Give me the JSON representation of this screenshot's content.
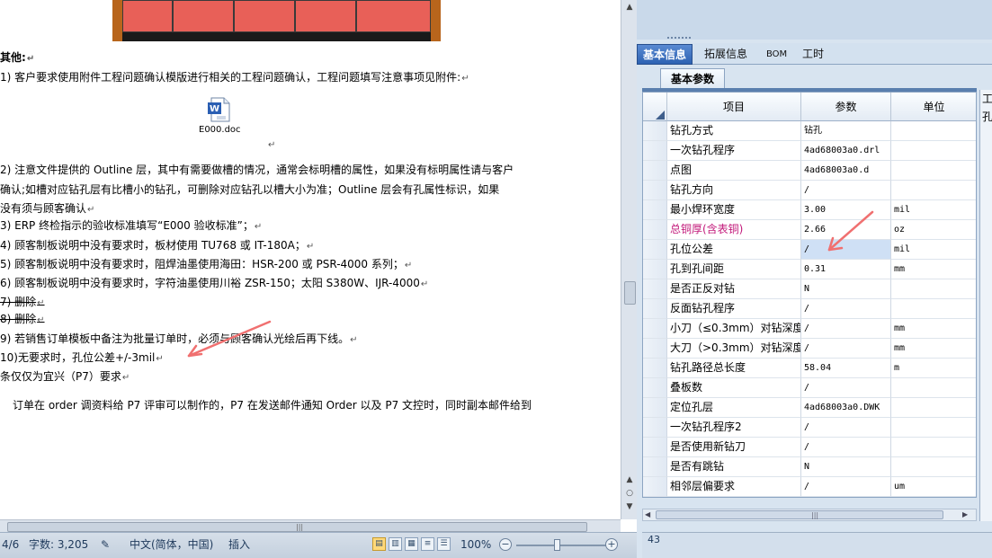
{
  "document": {
    "heading": "其他:",
    "items": [
      "1)  客户要求使用附件工程问题确认模版进行相关的工程问题确认，工程问题填写注意事项见附件:",
      "2)  注意文件提供的 Outline 层，其中有需要做槽的情况，通常会标明槽的属性，如果没有标明属性请与客户",
      "    确认;如槽对应钻孔层有比槽小的钻孔，可删除对应钻孔以槽大小为准；Outline 层会有孔属性标识，如果",
      "    没有须与顾客确认",
      "3)  ERP 终检指示的验收标准填写“E000 验收标准”；",
      "4)  顾客制板说明中没有要求时，板材使用 TU768 或 IT-180A；",
      "5)  顾客制板说明中没有要求时，阻焊油墨使用海田：HSR-200 或 PSR-4000 系列；",
      "6)  顾客制板说明中没有要求时，字符油墨使用川裕 ZSR-150；太阳 S380W、IJR-4000",
      "7)  删除",
      "8)  删除",
      "9)  若销售订单模板中备注为批量订单时，必须与顾客确认光绘后再下线。",
      "10)无要求时，孔位公差+/-3mil",
      "条仅仅为宜兴（P7）要求",
      "订单在 order 调资料给 P7 评审可以制作的，P7 在发送邮件通知 Order 以及 P7 文控时，同时副本邮件给到"
    ],
    "attachment_name": "E000.doc",
    "attachment_icon": "word-document-icon"
  },
  "statusbar": {
    "page": "4/6",
    "word_count": "字数: 3,205",
    "language": "中文(简体，中国)",
    "mode": "插入",
    "zoom": "100%",
    "zoom_minus": "−",
    "zoom_plus": "+"
  },
  "panel": {
    "tabs": [
      "基本信息",
      "拓展信息",
      "BOM",
      "工时"
    ],
    "active_tab": "基本信息",
    "subtab": "基本参数",
    "columns": [
      "项目",
      "参数",
      "单位"
    ],
    "rows": [
      {
        "item": "钻孔方式",
        "value": "钻孔",
        "unit": ""
      },
      {
        "item": "一次钻孔程序",
        "value": "4ad68003a0.drl",
        "unit": ""
      },
      {
        "item": "点图",
        "value": "4ad68003a0.d",
        "unit": ""
      },
      {
        "item": "钻孔方向",
        "value": "/",
        "unit": ""
      },
      {
        "item": "最小焊环宽度",
        "value": "3.00",
        "unit": "mil"
      },
      {
        "item": "总铜厚(含表铜)",
        "value": "2.66",
        "unit": "oz"
      },
      {
        "item": "孔位公差",
        "value": "/",
        "unit": "mil"
      },
      {
        "item": "孔到孔间距",
        "value": "0.31",
        "unit": "mm"
      },
      {
        "item": "是否正反对钻",
        "value": "N",
        "unit": ""
      },
      {
        "item": "反面钻孔程序",
        "value": "/",
        "unit": ""
      },
      {
        "item": "小刀（≤0.3mm）对钻深度",
        "value": "/",
        "unit": "mm"
      },
      {
        "item": "大刀（>0.3mm）对钻深度",
        "value": "/",
        "unit": "mm"
      },
      {
        "item": "钻孔路径总长度",
        "value": "58.04",
        "unit": "m"
      },
      {
        "item": "叠板数",
        "value": "/",
        "unit": ""
      },
      {
        "item": "定位孔层",
        "value": "4ad68003a0.DWK",
        "unit": ""
      },
      {
        "item": "一次钻孔程序2",
        "value": "/",
        "unit": ""
      },
      {
        "item": "是否使用新钻刀",
        "value": "/",
        "unit": ""
      },
      {
        "item": "是否有跳钻",
        "value": "N",
        "unit": ""
      },
      {
        "item": "相邻层偏要求",
        "value": "/",
        "unit": "um"
      }
    ],
    "record_count": "43",
    "side_labels": [
      "工",
      "孔"
    ]
  },
  "colors": {
    "annotation_arrow": "#f07070",
    "highlight_label": "#c2187a",
    "active_tab": "#2d62b2"
  }
}
